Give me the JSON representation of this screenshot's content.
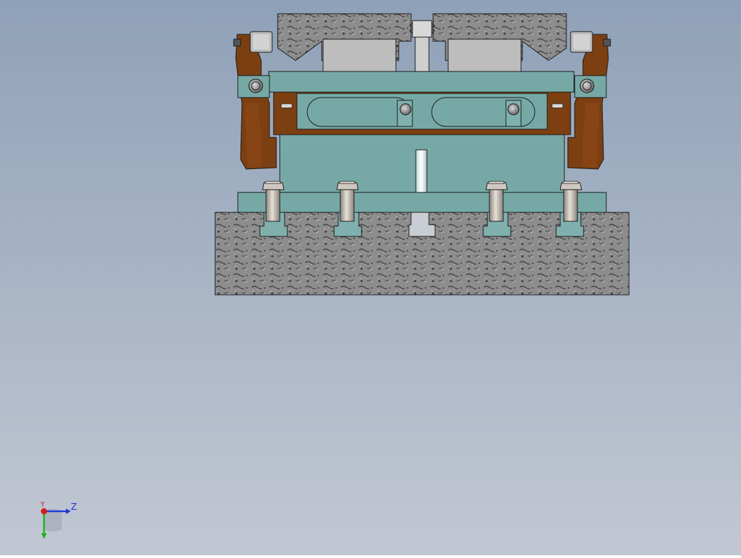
{
  "viewport": {
    "background_top": "#8fa1b8",
    "background_bottom": "#c1c6d2",
    "view_name": "cad-front-view"
  },
  "model": {
    "colors": {
      "concrete": "#8e8e8e",
      "concrete_dark": "#5c5c5c",
      "teal_plate": "#76a9a5",
      "teal_dark": "#2f5250",
      "brown_arm": "#7b3f12",
      "brown_dark": "#5a2c0a",
      "bolt": "#c8c0b8",
      "pad": "#bdbdbd",
      "outline": "#1a1a1a"
    }
  },
  "triad": {
    "z_label": "Z",
    "y_label": "Y",
    "x_color": "#d41c1c",
    "y_color": "#18b418",
    "z_color": "#1f3bd6"
  }
}
